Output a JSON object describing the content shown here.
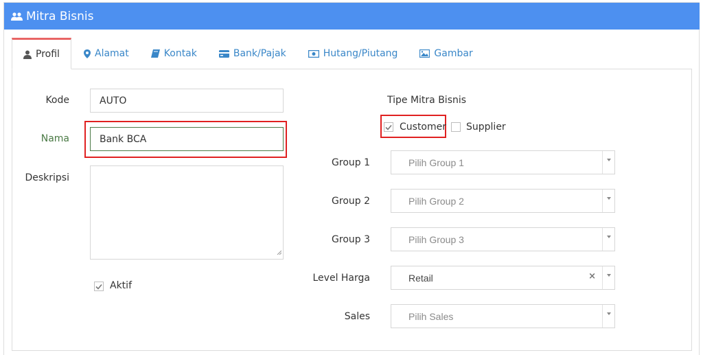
{
  "header": {
    "title": "Mitra Bisnis",
    "icon": "users-icon"
  },
  "tabs": [
    {
      "label": "Profil",
      "icon": "user-icon"
    },
    {
      "label": "Alamat",
      "icon": "map-marker-icon"
    },
    {
      "label": "Kontak",
      "icon": "book-icon"
    },
    {
      "label": "Bank/Pajak",
      "icon": "credit-card-icon"
    },
    {
      "label": "Hutang/Piutang",
      "icon": "money-icon"
    },
    {
      "label": "Gambar",
      "icon": "image-icon"
    }
  ],
  "form": {
    "kode_label": "Kode",
    "kode_value": "AUTO",
    "nama_label": "Nama",
    "nama_value": "Bank BCA",
    "deskripsi_label": "Deskripsi",
    "deskripsi_value": "",
    "aktif_label": "Aktif",
    "aktif_checked": true,
    "tipe_label": "Tipe Mitra Bisnis",
    "customer_label": "Customer",
    "customer_checked": true,
    "supplier_label": "Supplier",
    "supplier_checked": false,
    "group1_label": "Group 1",
    "group1_placeholder": "Pilih Group 1",
    "group2_label": "Group 2",
    "group2_placeholder": "Pilih Group 2",
    "group3_label": "Group 3",
    "group3_placeholder": "Pilih Group 3",
    "level_harga_label": "Level Harga",
    "level_harga_value": "Retail",
    "level_harga_clear": "×",
    "sales_label": "Sales",
    "sales_placeholder": "Pilih Sales"
  },
  "colors": {
    "header": "#4d90f0",
    "tab_link": "#3a87c8",
    "active_tab_top": "#e86565",
    "highlight": "#e02020",
    "nama_label": "#4a7a45"
  }
}
